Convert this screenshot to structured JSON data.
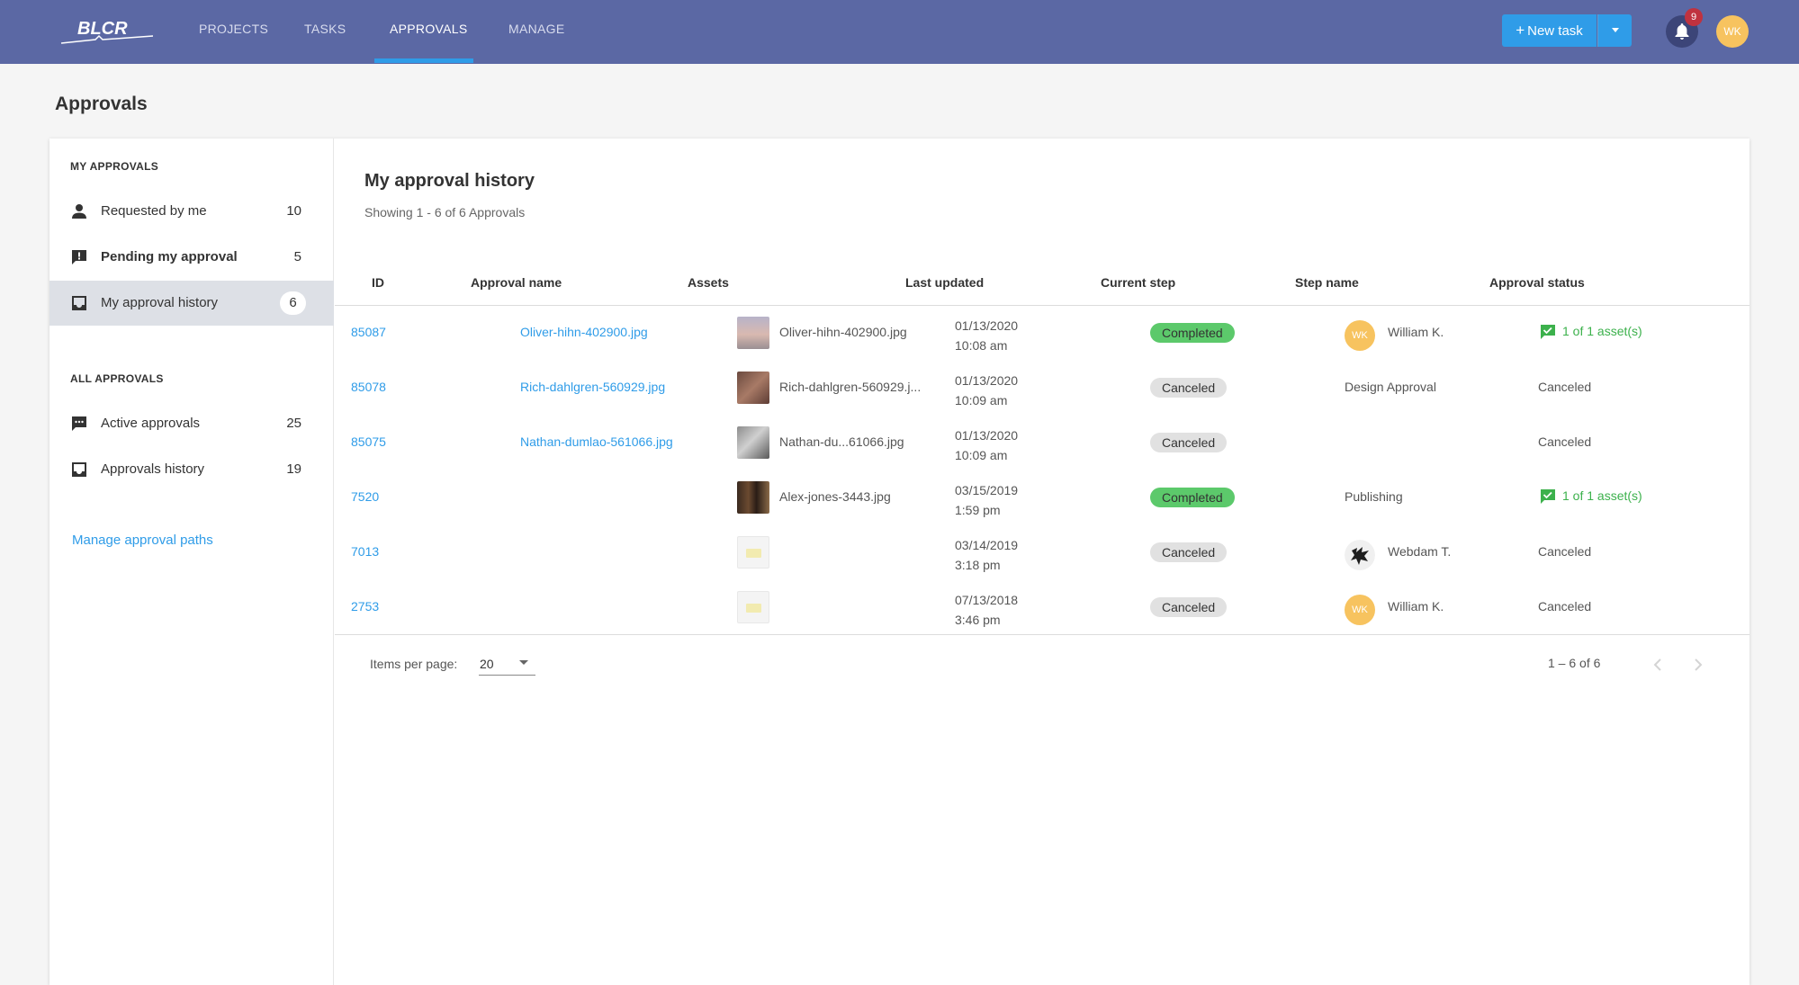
{
  "brand": {
    "logo_text": "BLCR"
  },
  "nav": {
    "items": [
      {
        "label": "PROJECTS"
      },
      {
        "label": "TASKS"
      },
      {
        "label": "APPROVALS"
      },
      {
        "label": "MANAGE"
      }
    ],
    "active": "APPROVALS"
  },
  "header_actions": {
    "new_task_label": "New task",
    "notification_count": "9",
    "user_initials": "WK"
  },
  "page": {
    "title": "Approvals"
  },
  "sidebar": {
    "my_heading": "MY APPROVALS",
    "my_items": [
      {
        "label": "Requested by me",
        "count": "10",
        "icon": "person-icon"
      },
      {
        "label": "Pending my approval",
        "count": "5",
        "icon": "alert-message-icon"
      },
      {
        "label": "My approval history",
        "count": "6",
        "icon": "inbox-icon"
      }
    ],
    "all_heading": "ALL APPROVALS",
    "all_items": [
      {
        "label": "Active approvals",
        "count": "25",
        "icon": "chat-bubble-icon"
      },
      {
        "label": "Approvals history",
        "count": "19",
        "icon": "inbox-icon"
      }
    ],
    "manage_link": "Manage approval paths"
  },
  "main": {
    "title": "My approval history",
    "subtitle": "Showing 1 - 6 of 6 Approvals",
    "columns": [
      "ID",
      "Approval name",
      "Assets",
      "Last updated",
      "Current step",
      "Step name",
      "Approval status"
    ],
    "rows": [
      {
        "id": "85087",
        "name": "Oliver-hihn-402900.jpg",
        "asset": "Oliver-hihn-402900.jpg",
        "date": "01/13/2020",
        "time": "10:08 am",
        "step": "Completed",
        "step_name": "William K.",
        "step_initials": "WK",
        "status": "1 of 1 asset(s)"
      },
      {
        "id": "85078",
        "name": "Rich-dahlgren-560929.jpg",
        "asset": "Rich-dahlgren-560929.j...",
        "date": "01/13/2020",
        "time": "10:09 am",
        "step": "Canceled",
        "step_name": "Design Approval",
        "status": "Canceled"
      },
      {
        "id": "85075",
        "name": "Nathan-dumlao-561066.jpg",
        "asset": "Nathan-du...61066.jpg",
        "date": "01/13/2020",
        "time": "10:09 am",
        "step": "Canceled",
        "step_name": "",
        "status": "Canceled"
      },
      {
        "id": "7520",
        "name": "",
        "asset": "Alex-jones-3443.jpg",
        "date": "03/15/2019",
        "time": "1:59 pm",
        "step": "Completed",
        "step_name": "Publishing",
        "status": "1 of 1 asset(s)"
      },
      {
        "id": "7013",
        "name": "",
        "asset": "",
        "date": "03/14/2019",
        "time": "3:18 pm",
        "step": "Canceled",
        "step_name": "Webdam T.",
        "status": "Canceled"
      },
      {
        "id": "2753",
        "name": "",
        "asset": "",
        "date": "07/13/2018",
        "time": "3:46 pm",
        "step": "Canceled",
        "step_name": "William K.",
        "step_initials": "WK",
        "status": "Canceled"
      }
    ]
  },
  "pagination": {
    "items_per_page_label": "Items per page:",
    "items_per_page_value": "20",
    "range": "1 – 6 of 6"
  },
  "colors": {
    "topbar": "#5b68a4",
    "accent": "#2f9ce8",
    "completed": "#5cc96b",
    "canceled": "#e1e1e1",
    "avatar": "#f7c35f"
  }
}
